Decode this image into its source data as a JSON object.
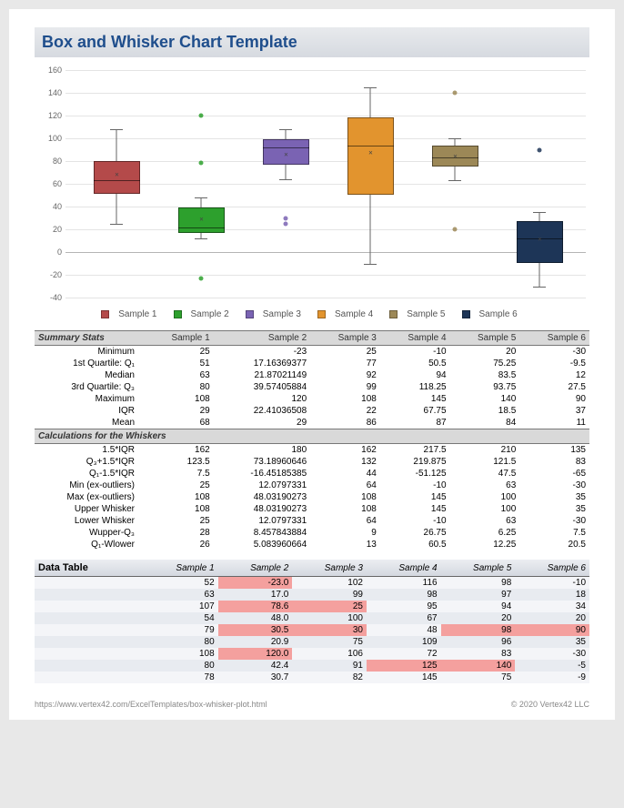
{
  "title": "Box and Whisker Chart Template",
  "footer": {
    "url": "https://www.vertex42.com/ExcelTemplates/box-whisker-plot.html",
    "copyright": "© 2020 Vertex42 LLC"
  },
  "series_names": [
    "Sample 1",
    "Sample 2",
    "Sample 3",
    "Sample 4",
    "Sample 5",
    "Sample 6"
  ],
  "series_colors": [
    "#b44a4a",
    "#2da02d",
    "#7a63b3",
    "#e2942e",
    "#9c8857",
    "#1d3557"
  ],
  "chart_data": {
    "type": "boxplot",
    "ylim": [
      -40,
      160
    ],
    "yticks": [
      -40,
      -20,
      0,
      20,
      40,
      60,
      80,
      100,
      120,
      140,
      160
    ],
    "series": [
      {
        "name": "Sample 1",
        "color": "#b44a4a",
        "q1": 51,
        "median": 63,
        "q3": 80,
        "low": 25,
        "high": 108,
        "mean": 68,
        "outliers": []
      },
      {
        "name": "Sample 2",
        "color": "#2da02d",
        "q1": 17.16,
        "median": 21.87,
        "q3": 39.57,
        "low": 12.08,
        "high": 48.03,
        "mean": 29,
        "outliers": [
          -23,
          78.6,
          120
        ]
      },
      {
        "name": "Sample 3",
        "color": "#7a63b3",
        "q1": 77,
        "median": 92,
        "q3": 99,
        "low": 64,
        "high": 108,
        "mean": 86,
        "outliers": [
          25,
          30
        ]
      },
      {
        "name": "Sample 4",
        "color": "#e2942e",
        "q1": 50.5,
        "median": 94,
        "q3": 118.25,
        "low": -10,
        "high": 145,
        "mean": 87,
        "outliers": []
      },
      {
        "name": "Sample 5",
        "color": "#9c8857",
        "q1": 75.25,
        "median": 83.5,
        "q3": 93.75,
        "low": 63,
        "high": 100,
        "mean": 84,
        "outliers": [
          20,
          140
        ]
      },
      {
        "name": "Sample 6",
        "color": "#1d3557",
        "q1": -9.5,
        "median": 12,
        "q3": 27.5,
        "low": -30,
        "high": 35,
        "mean": 11,
        "outliers": [
          90
        ]
      }
    ]
  },
  "summary_header": "Summary Stats",
  "summary_rows": [
    {
      "label": "Minimum",
      "v": [
        "25",
        "-23",
        "25",
        "-10",
        "20",
        "-30"
      ]
    },
    {
      "label": "1st Quartile: Q₁",
      "v": [
        "51",
        "17.16369377",
        "77",
        "50.5",
        "75.25",
        "-9.5"
      ]
    },
    {
      "label": "Median",
      "v": [
        "63",
        "21.87021149",
        "92",
        "94",
        "83.5",
        "12"
      ]
    },
    {
      "label": "3rd Quartile: Q₃",
      "v": [
        "80",
        "39.57405884",
        "99",
        "118.25",
        "93.75",
        "27.5"
      ]
    },
    {
      "label": "Maximum",
      "v": [
        "108",
        "120",
        "108",
        "145",
        "140",
        "90"
      ]
    },
    {
      "label": "IQR",
      "v": [
        "29",
        "22.41036508",
        "22",
        "67.75",
        "18.5",
        "37"
      ]
    },
    {
      "label": "Mean",
      "v": [
        "68",
        "29",
        "86",
        "87",
        "84",
        "11"
      ]
    }
  ],
  "calc_header": "Calculations for the Whiskers",
  "calc_rows": [
    {
      "label": "1.5*IQR",
      "v": [
        "162",
        "180",
        "162",
        "217.5",
        "210",
        "135"
      ]
    },
    {
      "label": "Q₃+1.5*IQR",
      "v": [
        "123.5",
        "73.18960646",
        "132",
        "219.875",
        "121.5",
        "83"
      ]
    },
    {
      "label": "Q₁-1.5*IQR",
      "v": [
        "7.5",
        "-16.45185385",
        "44",
        "-51.125",
        "47.5",
        "-65"
      ]
    },
    {
      "label": "Min (ex-outliers)",
      "v": [
        "25",
        "12.0797331",
        "64",
        "-10",
        "63",
        "-30"
      ]
    },
    {
      "label": "Max (ex-outliers)",
      "v": [
        "108",
        "48.03190273",
        "108",
        "145",
        "100",
        "35"
      ]
    },
    {
      "label": "Upper Whisker",
      "v": [
        "108",
        "48.03190273",
        "108",
        "145",
        "100",
        "35"
      ]
    },
    {
      "label": "Lower Whisker",
      "v": [
        "25",
        "12.0797331",
        "64",
        "-10",
        "63",
        "-30"
      ]
    },
    {
      "label": "Wupper-Q₃",
      "v": [
        "28",
        "8.457843884",
        "9",
        "26.75",
        "6.25",
        "7.5"
      ],
      "sub": "upper"
    },
    {
      "label": "Q₁-Wlower",
      "v": [
        "26",
        "5.083960664",
        "13",
        "60.5",
        "12.25",
        "20.5"
      ],
      "sub": "lower"
    }
  ],
  "data_table_header": "Data Table",
  "data_table_highlight": {
    "0": [
      1
    ],
    "2": [
      1,
      2
    ],
    "4": [
      1,
      2,
      4,
      5
    ],
    "6": [
      1
    ],
    "7": [
      3,
      4
    ]
  },
  "data_table": [
    [
      "52",
      "-23.0",
      "102",
      "116",
      "98",
      "-10"
    ],
    [
      "63",
      "17.0",
      "99",
      "98",
      "97",
      "18"
    ],
    [
      "107",
      "78.6",
      "25",
      "95",
      "94",
      "34"
    ],
    [
      "54",
      "48.0",
      "100",
      "67",
      "20",
      "20"
    ],
    [
      "79",
      "30.5",
      "30",
      "48",
      "98",
      "90"
    ],
    [
      "80",
      "20.9",
      "75",
      "109",
      "96",
      "35"
    ],
    [
      "108",
      "120.0",
      "106",
      "72",
      "83",
      "-30"
    ],
    [
      "80",
      "42.4",
      "91",
      "125",
      "140",
      "-5"
    ],
    [
      "78",
      "30.7",
      "82",
      "145",
      "75",
      "-9"
    ]
  ]
}
